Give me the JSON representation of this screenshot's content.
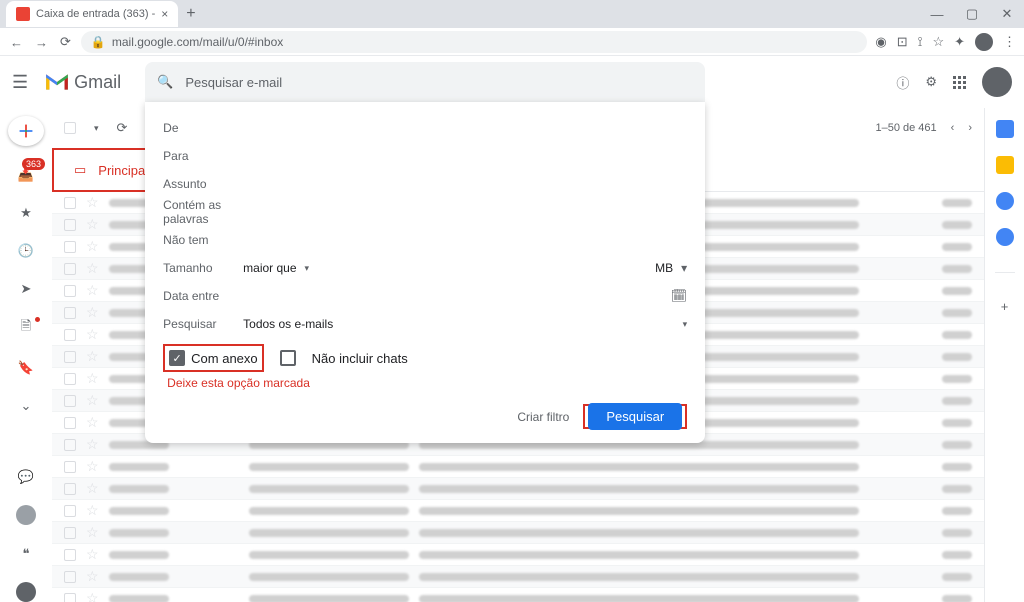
{
  "browser": {
    "tab_title": "Caixa de entrada (363) -",
    "url": "mail.google.com/mail/u/0/#inbox"
  },
  "header": {
    "app_name": "Gmail",
    "search_placeholder": "Pesquisar e-mail"
  },
  "search_form": {
    "from_label": "De",
    "to_label": "Para",
    "subject_label": "Assunto",
    "has_words_label": "Contém as palavras",
    "doesnt_have_label": "Não tem",
    "size_label": "Tamanho",
    "size_op": "maior que",
    "size_unit": "MB",
    "date_label": "Data entre",
    "search_in_label": "Pesquisar",
    "search_in_value": "Todos os e-mails",
    "has_attachment": "Com anexo",
    "exclude_chats": "Não incluir chats",
    "create_filter": "Criar filtro",
    "search_btn": "Pesquisar"
  },
  "annotation": {
    "text": "Deixe esta opção marcada"
  },
  "toolbar": {
    "count": "1–50 de 461"
  },
  "tabs": {
    "primary": "Principal"
  },
  "sidebar_badge": "363"
}
